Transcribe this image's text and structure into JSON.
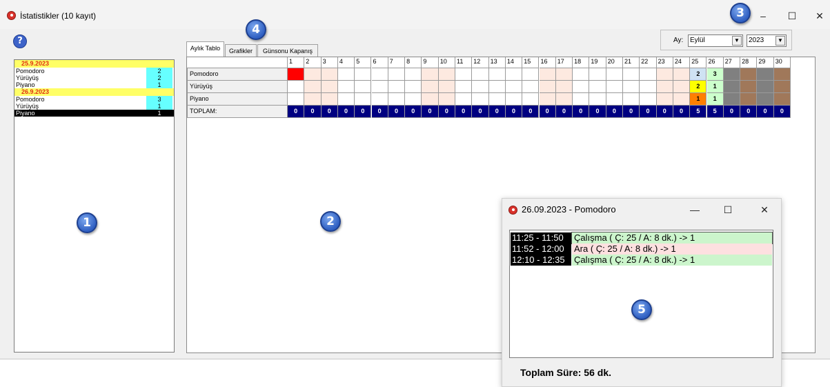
{
  "window": {
    "title": "İstatistikler (10 kayıt)",
    "minimize": "–",
    "maximize": "☐",
    "close": "✕"
  },
  "help_icon": "?",
  "left_list": {
    "groups": [
      {
        "date": "25.9.2023",
        "items": [
          {
            "label": "Pomodoro",
            "count": "2"
          },
          {
            "label": "Yürüyüş",
            "count": "2"
          },
          {
            "label": "Piyano",
            "count": "1"
          }
        ]
      },
      {
        "date": "26.9.2023",
        "items": [
          {
            "label": "Pomodoro",
            "count": "3"
          },
          {
            "label": "Yürüyüş",
            "count": "1"
          },
          {
            "label": "Piyano",
            "count": "1",
            "selected": true
          }
        ]
      }
    ]
  },
  "filter": {
    "month_label": "Ay:",
    "month_value": "Eylül",
    "year_value": "2023",
    "dropdown_arrow": "▼"
  },
  "tabs": [
    {
      "label": "Aylık Tablo",
      "active": true
    },
    {
      "label": "Grafikler",
      "active": false
    },
    {
      "label": "Günsonu Kapanış",
      "active": false
    }
  ],
  "grid": {
    "days": [
      "1",
      "2",
      "3",
      "4",
      "5",
      "6",
      "7",
      "8",
      "9",
      "10",
      "11",
      "12",
      "13",
      "14",
      "15",
      "16",
      "17",
      "18",
      "19",
      "20",
      "21",
      "22",
      "23",
      "24",
      "25",
      "26",
      "27",
      "28",
      "29",
      "30"
    ],
    "rows": [
      {
        "label": "Pomodoro",
        "values": {
          "25": "2",
          "26": "3"
        }
      },
      {
        "label": "Yürüyüş",
        "values": {
          "25": "2",
          "26": "1"
        }
      },
      {
        "label": "Piyano",
        "values": {
          "25": "1",
          "26": "1"
        }
      }
    ],
    "total_label": "TOPLAM:",
    "totals": [
      "0",
      "0",
      "0",
      "0",
      "0",
      "0",
      "0",
      "0",
      "0",
      "0",
      "0",
      "0",
      "0",
      "0",
      "0",
      "0",
      "0",
      "0",
      "0",
      "0",
      "0",
      "0",
      "0",
      "0",
      "5",
      "5",
      "0",
      "0",
      "0",
      "0"
    ],
    "colors": {
      "weekend": "#fde9e0",
      "today_marker": "#ff0000",
      "pomodoro_25": "#cfe2f3",
      "pomodoro_26": "#ccffcc",
      "yuruyus_25": "#ffff00",
      "yuruyus_26": "#ccffcc",
      "piyano_25": "#ff7f00",
      "piyano_26": "#ccffcc",
      "future_gray": "#808080",
      "future_brown": "#a0785a",
      "total_bg": "#000080"
    }
  },
  "popup": {
    "title": "26.09.2023 - Pomodoro",
    "minimize": "—",
    "maximize": "☐",
    "close": "✕",
    "sessions": [
      {
        "time": "11:25 - 11:50",
        "desc": "Çalışma ( Ç: 25 / A: 8 dk.) -> 1",
        "color": "#ccf5cc"
      },
      {
        "time": "11:52 - 12:00",
        "desc": "Ara ( Ç: 25 / A: 8 dk.) -> 1",
        "color": "#fde0e0"
      },
      {
        "time": "12:10 - 12:35",
        "desc": "Çalışma ( Ç: 25 / A: 8 dk.) -> 1",
        "color": "#ccf5cc"
      }
    ],
    "total": "Toplam Süre: 56 dk."
  },
  "callouts": [
    "1",
    "2",
    "3",
    "4",
    "5"
  ]
}
